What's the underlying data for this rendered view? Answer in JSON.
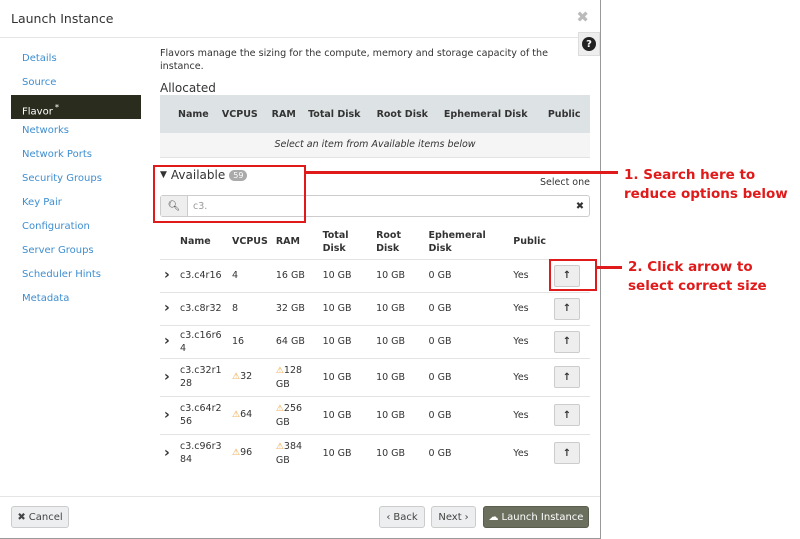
{
  "modal": {
    "title": "Launch Instance",
    "close_icon": "close-icon",
    "help_icon": "question-circle-icon"
  },
  "sidebar": {
    "items": [
      {
        "label": "Details"
      },
      {
        "label": "Source"
      },
      {
        "label": "Flavor",
        "required_marker": "*",
        "active": true
      },
      {
        "label": "Networks"
      },
      {
        "label": "Network Ports"
      },
      {
        "label": "Security Groups"
      },
      {
        "label": "Key Pair"
      },
      {
        "label": "Configuration"
      },
      {
        "label": "Server Groups"
      },
      {
        "label": "Scheduler Hints"
      },
      {
        "label": "Metadata"
      }
    ]
  },
  "content": {
    "description": "Flavors manage the sizing for the compute, memory and storage capacity of the instance.",
    "allocated": {
      "title": "Allocated",
      "empty_text": "Select an item from Available items below"
    },
    "columns": [
      "Name",
      "VCPUS",
      "RAM",
      "Total Disk",
      "Root Disk",
      "Ephemeral Disk",
      "Public"
    ],
    "available": {
      "title": "Available",
      "count": "59",
      "select_hint": "Select one",
      "search_value": "c3.",
      "rows": [
        {
          "name": "c3.c4r16",
          "vcpus": "4",
          "ram": "16 GB",
          "total_disk": "10 GB",
          "root_disk": "10 GB",
          "ephemeral": "0 GB",
          "public": "Yes",
          "warn": false
        },
        {
          "name": "c3.c8r32",
          "vcpus": "8",
          "ram": "32 GB",
          "total_disk": "10 GB",
          "root_disk": "10 GB",
          "ephemeral": "0 GB",
          "public": "Yes",
          "warn": false
        },
        {
          "name": "c3.c16r64",
          "vcpus": "16",
          "ram": "64 GB",
          "total_disk": "10 GB",
          "root_disk": "10 GB",
          "ephemeral": "0 GB",
          "public": "Yes",
          "warn": false
        },
        {
          "name": "c3.c32r128",
          "vcpus": "32",
          "ram": "128 GB",
          "total_disk": "10 GB",
          "root_disk": "10 GB",
          "ephemeral": "0 GB",
          "public": "Yes",
          "warn": true
        },
        {
          "name": "c3.c64r256",
          "vcpus": "64",
          "ram": "256 GB",
          "total_disk": "10 GB",
          "root_disk": "10 GB",
          "ephemeral": "0 GB",
          "public": "Yes",
          "warn": true
        },
        {
          "name": "c3.c96r384",
          "vcpus": "96",
          "ram": "384 GB",
          "total_disk": "10 GB",
          "root_disk": "10 GB",
          "ephemeral": "0 GB",
          "public": "Yes",
          "warn": true
        }
      ]
    }
  },
  "footer": {
    "cancel": "Cancel",
    "back": "Back",
    "next": "Next",
    "launch": "Launch Instance"
  },
  "annotations": {
    "note1": "1. Search here to reduce options below",
    "note2": "2. Click arrow to select correct size",
    "color": "#e01a1a"
  }
}
